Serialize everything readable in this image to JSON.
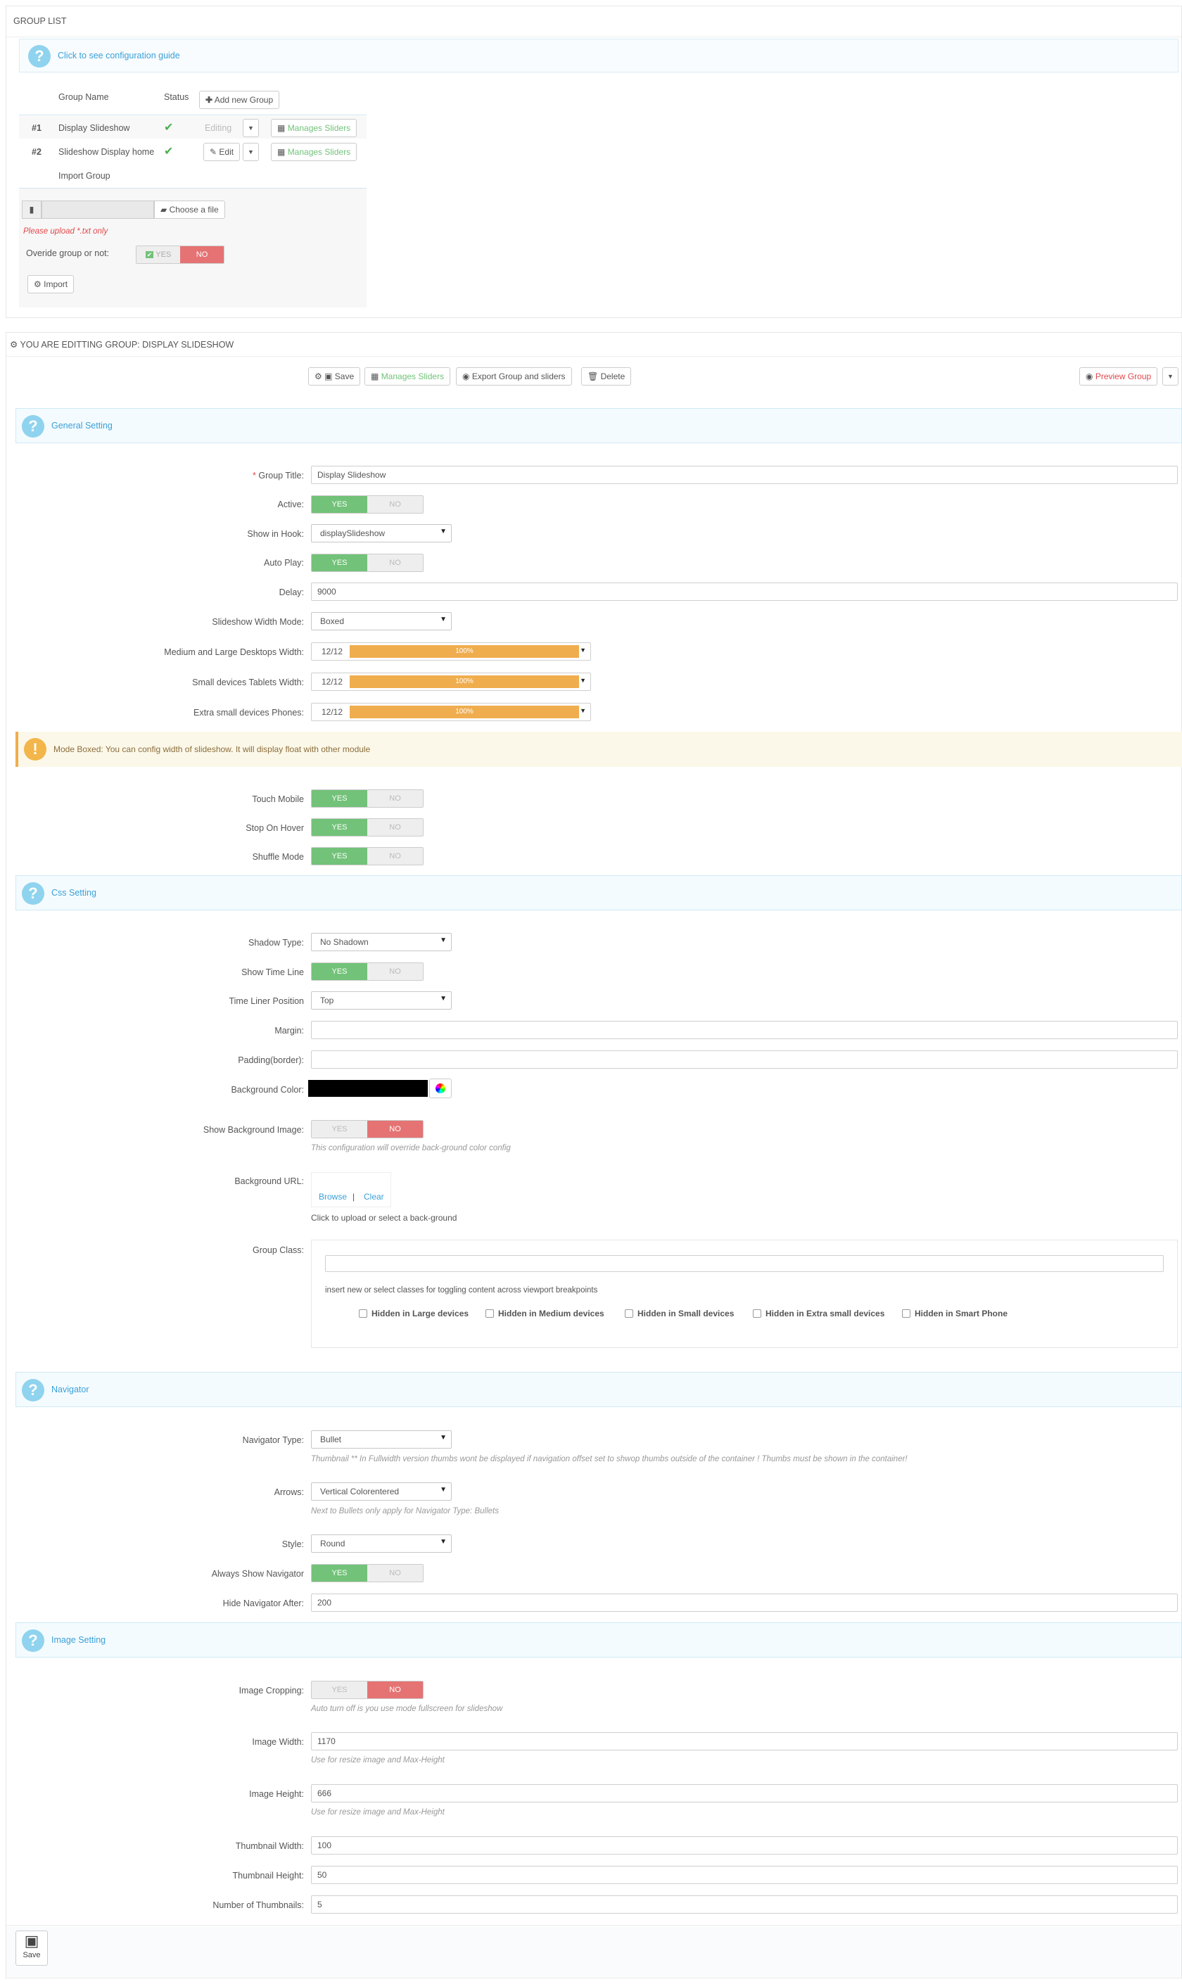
{
  "group_list": {
    "title": "GROUP LIST",
    "guide_link": "Click to see configuration guide",
    "col_group_name": "Group Name",
    "col_status": "Status",
    "add_button": "Add new Group",
    "rows": [
      {
        "id": "#1",
        "name": "Display Slideshow",
        "edit_label": "Editing",
        "manage_label": "Manages Sliders"
      },
      {
        "id": "#2",
        "name": "Slideshow Display home",
        "edit_label": "Edit",
        "manage_label": "Manages Sliders"
      }
    ],
    "import_title": "Import Group",
    "choose_file": "Choose a file",
    "upload_warning": "Please upload *.txt only",
    "override_label": "Overide group or not:",
    "yes": "YES",
    "no": "NO",
    "import_button": "Import"
  },
  "editor": {
    "title": "YOU ARE EDITTING GROUP: DISPLAY SLIDESHOW",
    "toolbar": {
      "save": "Save",
      "manage": "Manages Sliders",
      "export": "Export Group and sliders",
      "delete": "Delete",
      "preview": "Preview Group"
    },
    "general": {
      "heading": "General Setting",
      "group_title_label": "Group Title:",
      "group_title_value": "Display Slideshow",
      "active_label": "Active:",
      "hook_label": "Show in Hook:",
      "hook_value": "displaySlideshow",
      "autoplay_label": "Auto Play:",
      "delay_label": "Delay:",
      "delay_value": "9000",
      "width_mode_label": "Slideshow Width Mode:",
      "width_mode_value": "Boxed",
      "md_label": "Medium and Large Desktops Width:",
      "sm_label": "Small devices Tablets Width:",
      "xs_label": "Extra small devices Phones:",
      "col_value": "12/12",
      "bar_text": "100%",
      "bar_level": 1.0,
      "warning": "Mode Boxed: You can config width of slideshow. It will display float with other module",
      "touch_label": "Touch Mobile",
      "hover_label": "Stop On Hover",
      "shuffle_label": "Shuffle Mode"
    },
    "css": {
      "heading": "Css Setting",
      "shadow_label": "Shadow Type:",
      "shadow_value": "No Shadown",
      "timeline_label": "Show Time Line",
      "timeliner_label": "Time Liner Position",
      "timeliner_value": "Top",
      "margin_label": "Margin:",
      "padding_label": "Padding(border):",
      "bgcolor_label": "Background Color:",
      "bgcolor": "#000000",
      "show_bg_label": "Show Background Image:",
      "show_bg_hint": "This configuration will override back-ground color config",
      "bg_url_label": "Background URL:",
      "browse": "Browse",
      "separator": "|",
      "clear": "Clear",
      "bg_url_hint": "Click to upload or select a back-ground",
      "group_class_label": "Group Class:",
      "group_class_hint": "insert new or select classes for toggling content across viewport breakpoints",
      "checkboxes": [
        "Hidden in Large devices",
        "Hidden in Medium devices",
        "Hidden in Small devices",
        "Hidden in Extra small devices",
        "Hidden in Smart Phone"
      ]
    },
    "nav": {
      "heading": "Navigator",
      "type_label": "Navigator Type:",
      "type_value": "Bullet",
      "type_hint": "Thumbnail ** In Fullwidth version thumbs wont be displayed if navigation offset set to shwop thumbs outside of the container ! Thumbs must be shown in the container!",
      "arrows_label": "Arrows:",
      "arrows_value": "Vertical Colorentered",
      "arrows_hint": "Next to Bullets only apply for Navigator Type: Bullets",
      "style_label": "Style:",
      "style_value": "Round",
      "always_label": "Always Show Navigator",
      "hide_after_label": "Hide Navigator After:",
      "hide_after_value": "200"
    },
    "image": {
      "heading": "Image Setting",
      "crop_label": "Image Cropping:",
      "crop_hint": "Auto turn off is you use mode fullscreen for slideshow",
      "width_label": "Image Width:",
      "width_value": "1170",
      "width_hint": "Use for resize image and Max-Height",
      "height_label": "Image Height:",
      "height_value": "666",
      "height_hint": "Use for resize image and Max-Height",
      "thumb_w_label": "Thumbnail Width:",
      "thumb_w_value": "100",
      "thumb_h_label": "Thumbnail Height:",
      "thumb_h_value": "50",
      "thumb_n_label": "Number of Thumbnails:",
      "thumb_n_value": "5"
    },
    "footer_save": "Save"
  },
  "colors": {
    "accent": "#3aa0d8",
    "green": "#72c279",
    "red": "#e57373",
    "orange": "#f0ad4e"
  }
}
